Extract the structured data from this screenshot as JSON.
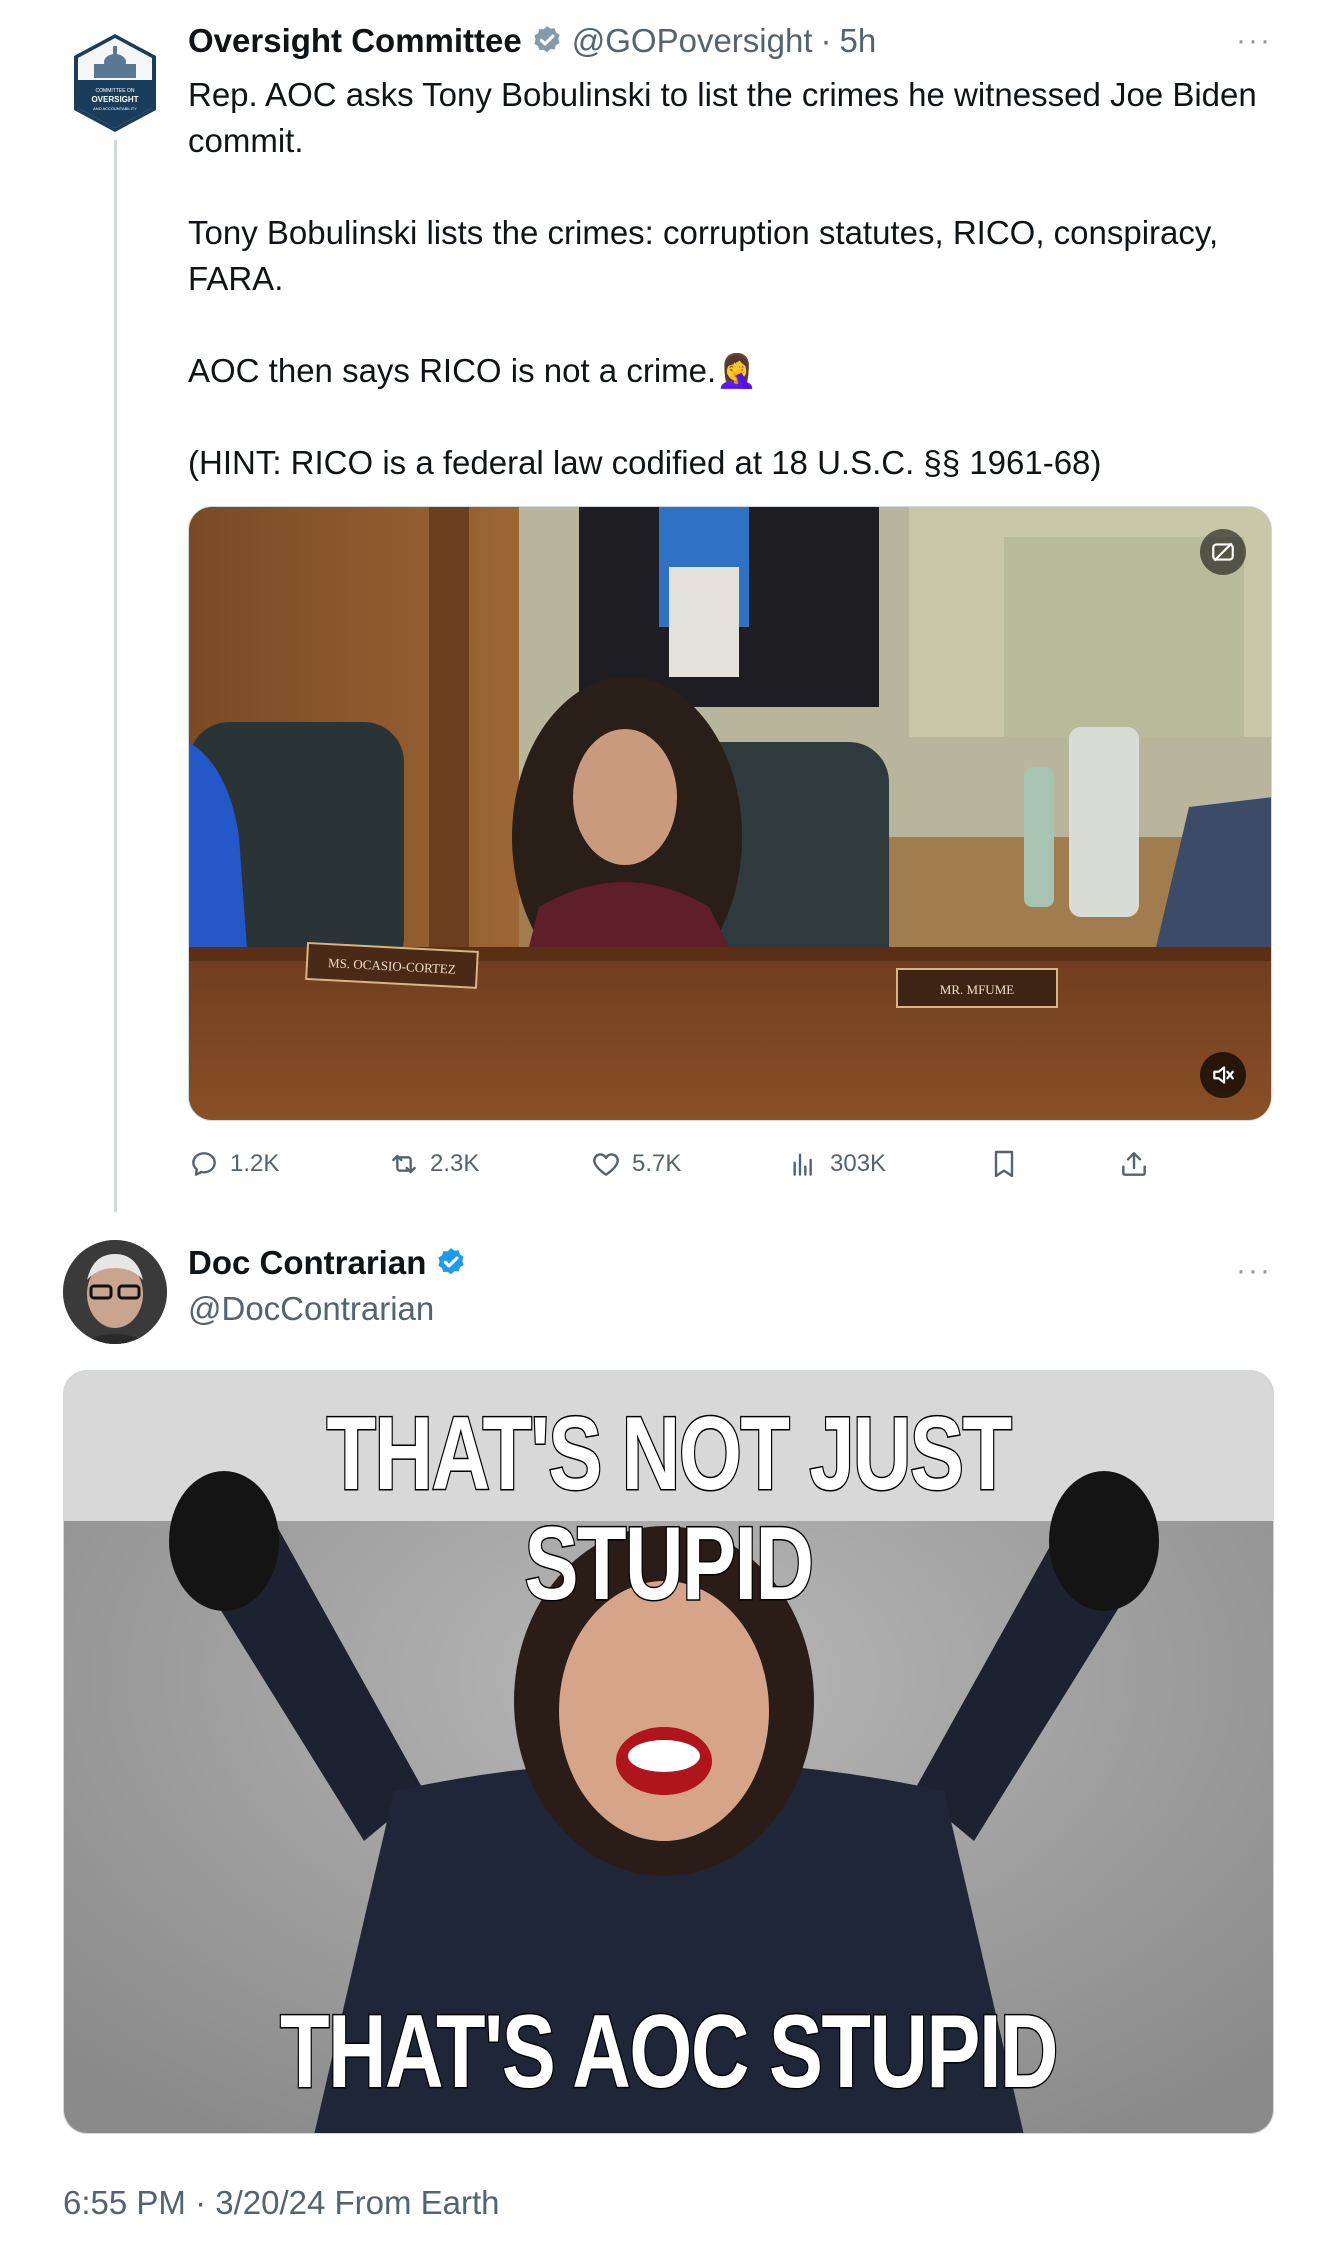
{
  "tweet1": {
    "display_name": "Oversight Committee",
    "handle": "@GOPoversight",
    "separator": "·",
    "time": "5h",
    "more": "···",
    "text_lines": [
      "Rep. AOC asks Tony Bobulinski to list the crimes he witnessed Joe Biden commit.",
      "Tony Bobulinski lists the crimes: corruption statutes, RICO, conspiracy, FARA.",
      "AOC then says RICO is not a crime.",
      "(HINT: RICO is a federal law codified at 18 U.S.C. §§ 1961-68)"
    ],
    "emoji": "🤦‍♀️",
    "avatar_text": {
      "line1": "COMMITTEE ON",
      "line2": "OVERSIGHT",
      "line3": "AND ACCOUNTABILITY"
    },
    "video": {
      "nameplate_left": "MS. OCASIO-CORTEZ",
      "nameplate_right": "MR. MFUME"
    },
    "actions": {
      "replies": "1.2K",
      "reposts": "2.3K",
      "likes": "5.7K",
      "views": "303K"
    }
  },
  "tweet2": {
    "display_name": "Doc Contrarian",
    "handle": "@DocContrarian",
    "more": "···",
    "meme_top": "THAT'S NOT JUST STUPID",
    "meme_bottom": "THAT'S AOC STUPID",
    "footer": "6:55 PM · 3/20/24 From Earth"
  },
  "colors": {
    "verified_gray": "#829aab",
    "verified_blue": "#1d9bf0",
    "secondary_text": "#536471",
    "thread_line": "#cfd9de"
  }
}
